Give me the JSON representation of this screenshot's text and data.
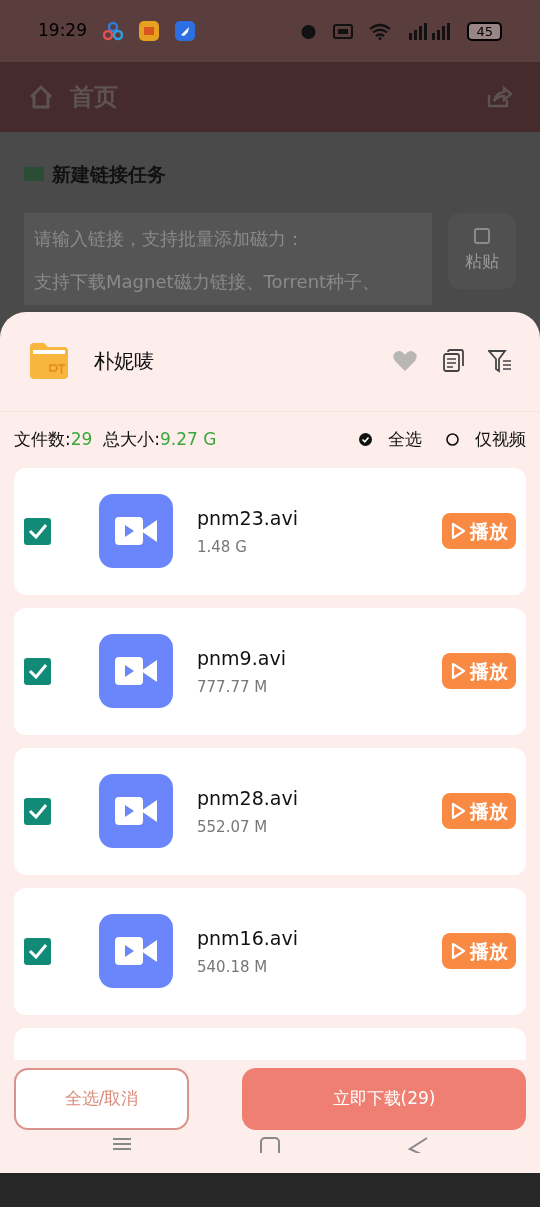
{
  "status_bar": {
    "time": "19:29",
    "battery": "45"
  },
  "header": {
    "title": "首页"
  },
  "task_form": {
    "title": "新建链接任务",
    "placeholder_lines": [
      "请输入链接，支持批量添加磁力：",
      "支持下载Magnet磁力链接、Torrent种子、"
    ],
    "paste_button": "粘贴"
  },
  "sheet": {
    "name": "朴妮唛",
    "favorite": false,
    "stats": {
      "file_count_label": "文件数:",
      "file_count": "29",
      "total_size_label": "总大小:",
      "total_size": "9.27 G"
    },
    "filters": [
      {
        "label": "全选",
        "selected": true
      },
      {
        "label": "仅视频",
        "selected": false
      }
    ],
    "files": [
      {
        "name": "pnm23.avi",
        "size": "1.48 G",
        "checked": true,
        "kind": "video",
        "play": "播放"
      },
      {
        "name": "pnm9.avi",
        "size": "777.77 M",
        "checked": true,
        "kind": "video",
        "play": "播放"
      },
      {
        "name": "pnm28.avi",
        "size": "552.07 M",
        "checked": true,
        "kind": "video",
        "play": "播放"
      },
      {
        "name": "pnm16.avi",
        "size": "540.18 M",
        "checked": true,
        "kind": "video",
        "play": "播放"
      }
    ],
    "select_button": "全选/取消",
    "download_button": "立即下载(29)"
  }
}
